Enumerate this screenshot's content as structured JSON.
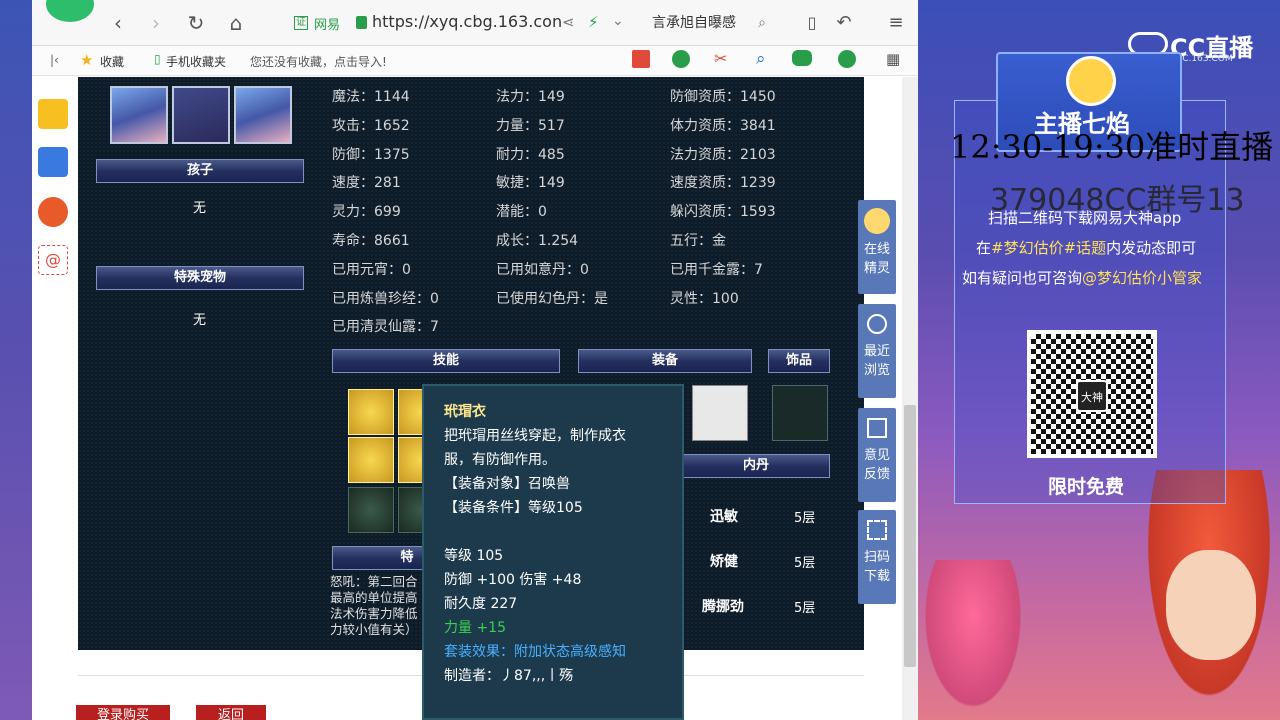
{
  "browser": {
    "nav": {
      "back": "‹",
      "forward": "›",
      "reload": "↻",
      "home": "⌂"
    },
    "url_prefix": "网易",
    "url": "https://xyq.cbg.163.con",
    "search_text": "言承旭自曝感",
    "bookmarks": {
      "fav": "收藏",
      "mobile_fav": "手机收藏夹",
      "import_hint": "您还没有收藏，点击导入!"
    }
  },
  "left_panel": {
    "child_header": "孩子",
    "child_value": "无",
    "special_pet_header": "特殊宠物",
    "special_pet_value": "无"
  },
  "stats": [
    [
      "魔法：1144",
      "法力：149",
      "防御资质：1450"
    ],
    [
      "攻击：1652",
      "力量：517",
      "体力资质：3841"
    ],
    [
      "防御：1375",
      "耐力：485",
      "法力资质：2103"
    ],
    [
      "速度：281",
      "敏捷：149",
      "速度资质：1239"
    ],
    [
      "灵力：699",
      "潜能：0",
      "躲闪资质：1593"
    ],
    [
      "寿命：8661",
      "成长：1.254",
      "五行：金"
    ],
    [
      "已用元宵：0",
      "已用如意丹：0",
      "已用千金露：7"
    ],
    [
      "已用炼兽珍经：0",
      "已使用幻色丹：是",
      "灵性：100"
    ],
    [
      "已用清灵仙露：7",
      "",
      ""
    ]
  ],
  "sections": {
    "skills": "技能",
    "equipment": "装备",
    "accessory": "饰品",
    "neidan": "内丹",
    "special": "特"
  },
  "neidan": [
    {
      "name": "迅敏",
      "level": "5层"
    },
    {
      "name": "矫健",
      "level": "5层"
    },
    {
      "name": "腾挪劲",
      "level": "5层"
    }
  ],
  "skill_desc": [
    "怒吼：第二回合",
    "最高的单位提高",
    "法术伤害力降低",
    "力较小值有关）"
  ],
  "tooltip": {
    "title": "玳瑁衣",
    "desc1": "把玳瑁用丝线穿起，制作成衣",
    "desc2": "服，有防御作用。",
    "target": "【装备对象】召唤兽",
    "condition": "【装备条件】等级105",
    "level": "等级 105",
    "stats": "防御 +100 伤害 +48",
    "durability": "耐久度 227",
    "strength": "力量 +15",
    "set_effect": "套装效果：附加状态高级感知",
    "maker": "制造者：丿87,,,丨殇"
  },
  "float_bar": [
    {
      "label1": "在线",
      "label2": "精灵"
    },
    {
      "label1": "最近",
      "label2": "浏览"
    },
    {
      "label1": "意见",
      "label2": "反馈"
    },
    {
      "label1": "扫码",
      "label2": "下载"
    }
  ],
  "buttons": {
    "buy": "登录购买",
    "back": "返回"
  },
  "stream": {
    "logo": "CC直播",
    "logo_sub": "CC.163.COM",
    "anchor": "主播七焰",
    "overlay_time": "12:30-19:30准时直播",
    "overlay_group": "379048CC群号13",
    "line1": "扫描二维码下载网易大神app",
    "line2a": "在",
    "line2b": "#梦幻估价#话题",
    "line2c": "内发动态即可",
    "line3a": "如有疑问也可咨询",
    "line3b": "@梦幻估价小管家",
    "qr_badge": "大神",
    "free": "限时免费"
  }
}
